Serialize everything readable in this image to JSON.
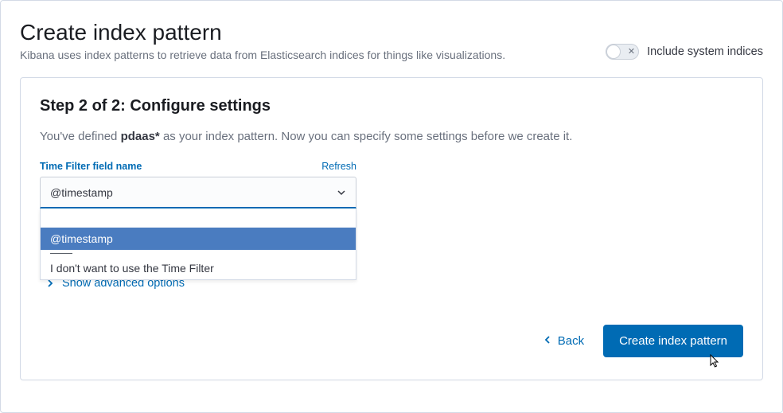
{
  "header": {
    "title": "Create index pattern",
    "subtitle": "Kibana uses index patterns to retrieve data from Elasticsearch indices for things like visualizations.",
    "toggle_label": "Include system indices"
  },
  "step": {
    "title": "Step 2 of 2: Configure settings",
    "defined_prefix": "You've defined ",
    "pattern_name": "pdaas*",
    "defined_suffix": " as your index pattern. Now you can specify some settings before we create it."
  },
  "time_filter": {
    "label": "Time Filter field name",
    "refresh": "Refresh",
    "selected": "@timestamp",
    "options": {
      "opt_timestamp": "@timestamp",
      "opt_none": "I don't want to use the Time Filter"
    }
  },
  "advanced": {
    "label": "Show advanced options"
  },
  "footer": {
    "back": "Back",
    "create": "Create index pattern"
  }
}
